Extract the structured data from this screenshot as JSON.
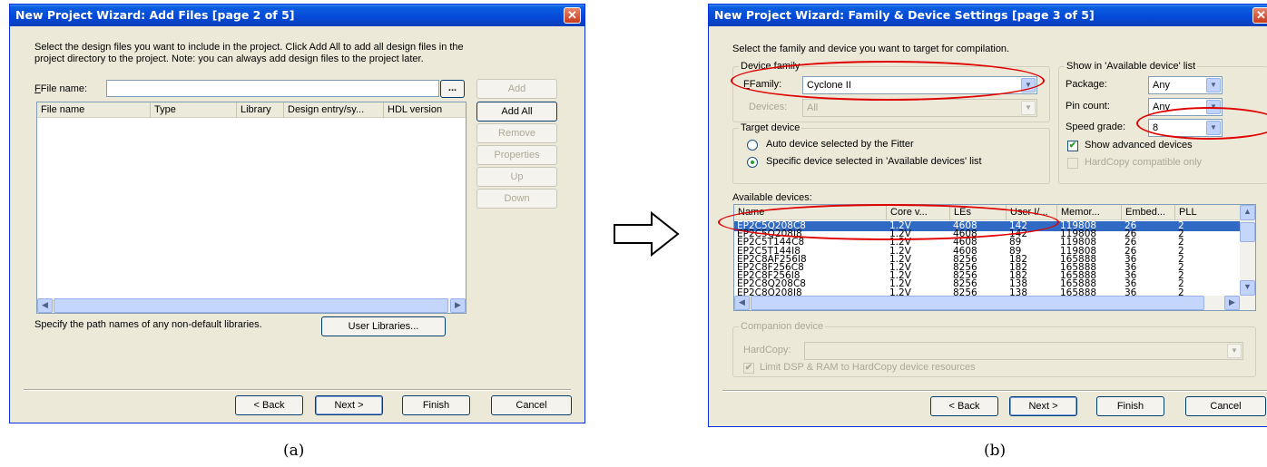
{
  "win_a": {
    "title": "New Project Wizard: Add Files [page 2 of 5]",
    "instruction_line1": "Select the design files you want to include in the project. Click Add All to add all design files in the",
    "instruction_line2": "project directory to the project. Note: you can always add design files to the project later.",
    "file_name_label": "File name:",
    "file_name_value": "",
    "browse_label": "...",
    "columns": [
      "File name",
      "Type",
      "Library",
      "Design entry/sy...",
      "HDL version"
    ],
    "buttons": {
      "add": "Add",
      "add_all": "Add All",
      "remove": "Remove",
      "properties": "Properties",
      "up": "Up",
      "down": "Down"
    },
    "libraries_text": "Specify the path names of any non-default libraries.",
    "user_libraries_button": "User Libraries...",
    "footer": {
      "back": "< Back",
      "next": "Next >",
      "finish": "Finish",
      "cancel": "Cancel"
    }
  },
  "win_b": {
    "title": "New Project Wizard: Family & Device Settings [page 3 of 5]",
    "instruction": "Select the family and device you want to target for compilation.",
    "device_family": {
      "group_label": "Device family",
      "family_label": "Family:",
      "family_value": "Cyclone II",
      "devices_label": "Devices:",
      "devices_value": "All"
    },
    "target_device": {
      "group_label": "Target device",
      "auto_label": "Auto device selected by the Fitter",
      "specific_label": "Specific device selected in 'Available devices' list"
    },
    "show_in": {
      "group_label": "Show in 'Available device' list",
      "package_label": "Package:",
      "package_value": "Any",
      "pin_count_label": "Pin count:",
      "pin_count_value": "Any",
      "speed_grade_label": "Speed grade:",
      "speed_grade_value": "8",
      "show_advanced_label": "Show advanced devices",
      "hardcopy_compatible_label": "HardCopy compatible only"
    },
    "available_devices_label": "Available devices:",
    "columns": [
      "Name",
      "Core v...",
      "LEs",
      "User I/...",
      "Memor...",
      "Embed...",
      "PLL"
    ],
    "devices": [
      [
        "EP2C5Q208C8",
        "1.2V",
        "4608",
        "142",
        "119808",
        "26",
        "2"
      ],
      [
        "EP2C5Q208I8",
        "1.2V",
        "4608",
        "142",
        "119808",
        "26",
        "2"
      ],
      [
        "EP2C5T144C8",
        "1.2V",
        "4608",
        "89",
        "119808",
        "26",
        "2"
      ],
      [
        "EP2C5T144I8",
        "1.2V",
        "4608",
        "89",
        "119808",
        "26",
        "2"
      ],
      [
        "EP2C8AF256I8",
        "1.2V",
        "8256",
        "182",
        "165888",
        "36",
        "2"
      ],
      [
        "EP2C8F256C8",
        "1.2V",
        "8256",
        "182",
        "165888",
        "36",
        "2"
      ],
      [
        "EP2C8F256I8",
        "1.2V",
        "8256",
        "182",
        "165888",
        "36",
        "2"
      ],
      [
        "EP2C8Q208C8",
        "1.2V",
        "8256",
        "138",
        "165888",
        "36",
        "2"
      ],
      [
        "EP2C8Q208I8",
        "1.2V",
        "8256",
        "138",
        "165888",
        "36",
        "2"
      ]
    ],
    "companion": {
      "group_label": "Companion device",
      "hardcopy_label": "HardCopy:",
      "hardcopy_value": "",
      "limit_label": "Limit DSP & RAM to HardCopy device resources"
    },
    "footer": {
      "back": "< Back",
      "next": "Next >",
      "finish": "Finish",
      "cancel": "Cancel"
    }
  },
  "captions": {
    "a": "(a)",
    "b": "(b)"
  },
  "arrow_icon": "right-arrow-icon",
  "highlight_color": "#e00000"
}
